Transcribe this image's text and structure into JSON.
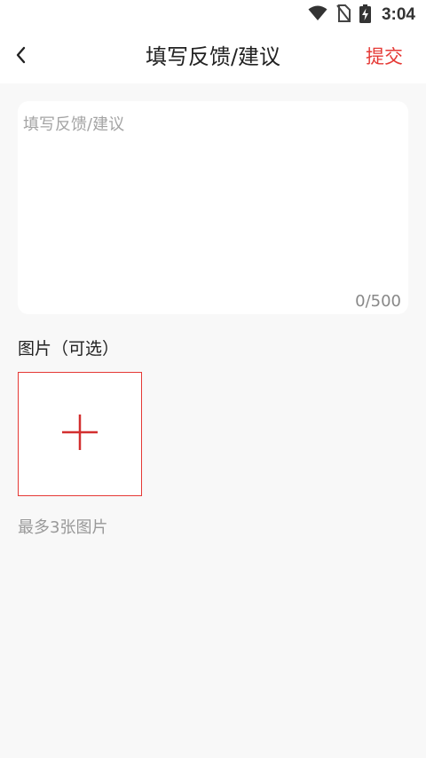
{
  "status_bar": {
    "time": "3:04",
    "icons": [
      "wifi-icon",
      "no-sim-icon",
      "battery-charging-icon"
    ]
  },
  "header": {
    "title": "填写反馈/建议",
    "submit_label": "提交",
    "back_icon": "chevron-left-icon"
  },
  "feedback": {
    "placeholder": "填写反馈/建议",
    "value": "",
    "char_count": "0/500"
  },
  "images": {
    "label": "图片（可选）",
    "add_icon": "plus-icon",
    "hint": "最多3张图片"
  },
  "colors": {
    "accent": "#e53935",
    "background": "#f8f8f8",
    "card": "#ffffff",
    "hint_text": "#999999"
  }
}
